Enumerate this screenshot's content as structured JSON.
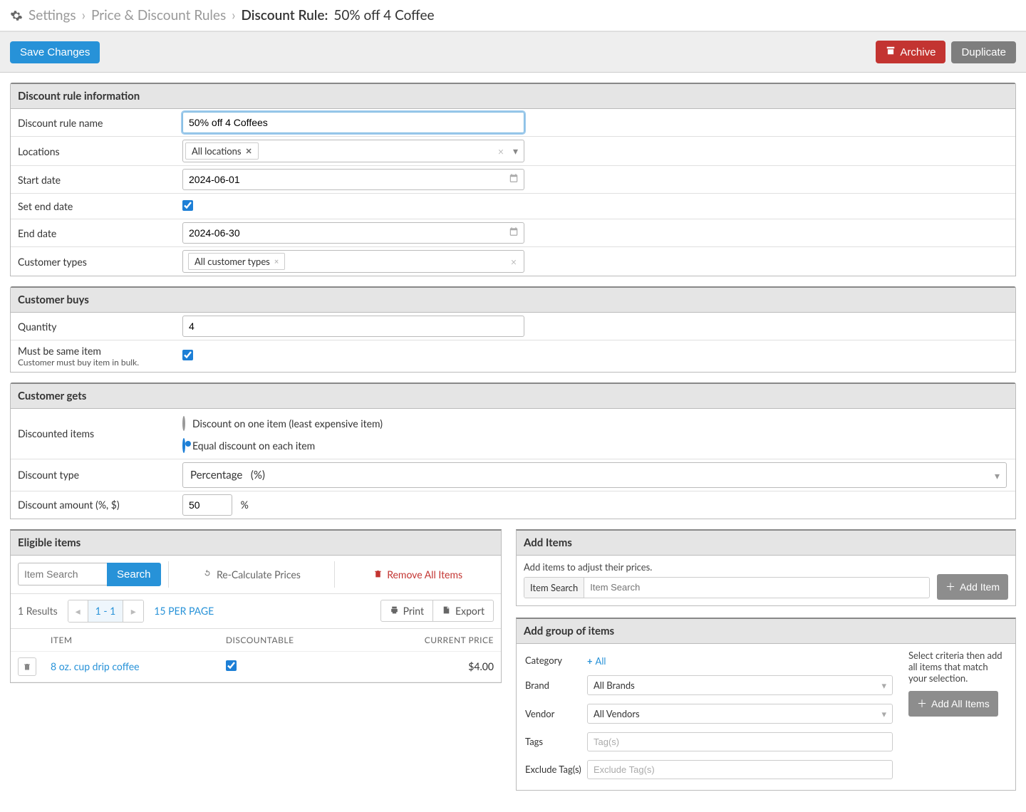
{
  "breadcrumb": {
    "item1": "Settings",
    "item2": "Price & Discount Rules",
    "current_prefix": "Discount Rule:",
    "current_name": "50% off 4 Coffee"
  },
  "toolbar": {
    "save": "Save Changes",
    "archive": "Archive",
    "duplicate": "Duplicate"
  },
  "info": {
    "header": "Discount rule information",
    "name_label": "Discount rule name",
    "name_value": "50% off 4 Coffees",
    "locations_label": "Locations",
    "locations_tag": "All locations",
    "start_label": "Start date",
    "start_value": "2024-06-01",
    "set_end_label": "Set end date",
    "end_label": "End date",
    "end_value": "2024-06-30",
    "cust_types_label": "Customer types",
    "cust_types_tag": "All customer types"
  },
  "buys": {
    "header": "Customer buys",
    "qty_label": "Quantity",
    "qty_value": "4",
    "same_label": "Must be same item",
    "same_sub": "Customer must buy item in bulk."
  },
  "gets": {
    "header": "Customer gets",
    "disc_items_label": "Discounted items",
    "radio1": "Discount on one item (least expensive item)",
    "radio2": "Equal discount on each item",
    "type_label": "Discount type",
    "type_value": "Percentage   (%)",
    "amount_label": "Discount amount (%, $)",
    "amount_value": "50",
    "amount_unit": "%"
  },
  "eligible": {
    "header": "Eligible items",
    "search_placeholder": "Item Search",
    "search_btn": "Search",
    "recalc": "Re-Calculate Prices",
    "remove_all": "Remove All Items",
    "results": "1 Results",
    "pager_active": "1 - 1",
    "per_page": "15 PER PAGE",
    "print": "Print",
    "export": "Export",
    "cols": {
      "item": "ITEM",
      "disc": "DISCOUNTABLE",
      "price": "CURRENT PRICE"
    },
    "rows": [
      {
        "name": "8 oz. cup drip coffee",
        "discountable": true,
        "price": "$4.00"
      }
    ]
  },
  "add": {
    "header": "Add Items",
    "help": "Add items to adjust their prices.",
    "item_search_lbl": "Item Search",
    "item_search_ph": "Item Search",
    "add_item_btn": "Add Item"
  },
  "group": {
    "header": "Add group of items",
    "category_lbl": "Category",
    "all": "All",
    "brand_lbl": "Brand",
    "brand_val": "All Brands",
    "vendor_lbl": "Vendor",
    "vendor_val": "All Vendors",
    "tags_lbl": "Tags",
    "tags_ph": "Tag(s)",
    "excl_lbl": "Exclude Tag(s)",
    "excl_ph": "Exclude Tag(s)",
    "hint": "Select criteria then add all items that match your selection.",
    "add_all_btn": "Add All Items"
  }
}
